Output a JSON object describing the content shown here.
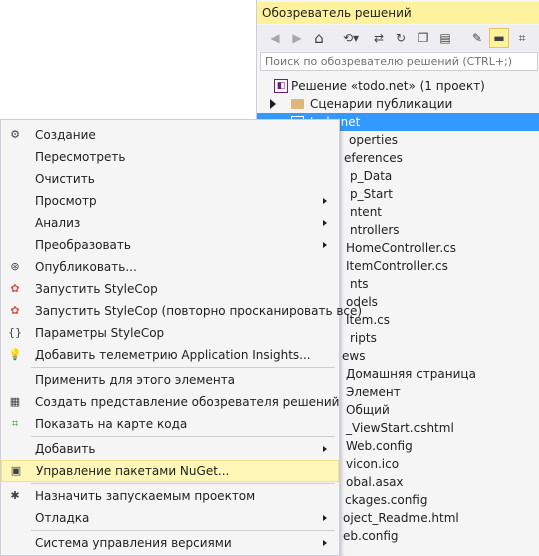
{
  "solution_explorer": {
    "title": "Обозреватель решений",
    "toolbar": [
      {
        "icon": "back-icon",
        "glyph": "◀"
      },
      {
        "icon": "forward-icon",
        "glyph": "▶"
      },
      {
        "icon": "home-icon",
        "glyph": "⌂"
      },
      {
        "icon": "history-icon",
        "glyph": "⟲▾"
      },
      {
        "icon": "sync-icon",
        "glyph": "⇄"
      },
      {
        "icon": "refresh-icon",
        "glyph": "↻"
      },
      {
        "icon": "collapse-all-icon",
        "glyph": "❐"
      },
      {
        "icon": "show-all-files-icon",
        "glyph": "▤"
      },
      {
        "icon": "properties-wrench-icon",
        "glyph": "✎"
      },
      {
        "icon": "preview-pin-icon",
        "glyph": "▬"
      },
      {
        "icon": "view-class-diagram-icon",
        "glyph": "⌗"
      }
    ],
    "search_placeholder": "Поиск по обозревателю решений (CTRL+;)",
    "tree": [
      {
        "text": "Решение «todo.net» (1 проект)"
      },
      {
        "text": "Сценарии публикации"
      },
      {
        "text": "todo.net"
      },
      {
        "text": "operties"
      },
      {
        "text": "eferences"
      },
      {
        "text": "p_Data"
      },
      {
        "text": "p_Start"
      },
      {
        "text": "ntent"
      },
      {
        "text": "ntrollers"
      },
      {
        "text": "HomeController.cs"
      },
      {
        "text": "ItemController.cs"
      },
      {
        "text": "nts"
      },
      {
        "text": "odels"
      },
      {
        "text": "Item.cs"
      },
      {
        "text": "ripts"
      },
      {
        "text": "ews"
      },
      {
        "text": "Домашняя страница"
      },
      {
        "text": "Элемент"
      },
      {
        "text": "Общий"
      },
      {
        "text": "_ViewStart.cshtml"
      },
      {
        "text": "Web.config"
      },
      {
        "text": "vicon.ico"
      },
      {
        "text": "obal.asax"
      },
      {
        "text": "ckages.config"
      },
      {
        "text": "oject_Readme.html"
      },
      {
        "text": "eb.config"
      }
    ]
  },
  "context_menu": {
    "items": [
      {
        "label": "Создание",
        "icon": "build-icon",
        "glyph": "⚙"
      },
      {
        "label": "Пересмотреть",
        "icon": "",
        "glyph": ""
      },
      {
        "label": "Очистить",
        "icon": "",
        "glyph": ""
      },
      {
        "label": "Просмотр",
        "icon": "",
        "glyph": "",
        "submenu": true
      },
      {
        "label": "Анализ",
        "icon": "",
        "glyph": "",
        "submenu": true
      },
      {
        "label": "Преобразовать",
        "icon": "",
        "glyph": "",
        "submenu": true
      },
      {
        "label": "Опубликовать...",
        "icon": "publish-icon",
        "glyph": "⊛"
      },
      {
        "label": "Запустить StyleCop",
        "icon": "stylecop-icon",
        "glyph": "✿"
      },
      {
        "label": "Запустить StyleCop (повторно просканировать все)",
        "icon": "stylecop-rescan-icon",
        "glyph": "✿"
      },
      {
        "label": "Параметры StyleCop",
        "icon": "settings-braces-icon",
        "glyph": "{}"
      },
      {
        "label": "Добавить телеметрию Application Insights...",
        "icon": "lightbulb-add-icon",
        "glyph": "💡"
      },
      {
        "label": "Применить для этого элемента",
        "icon": "",
        "glyph": ""
      },
      {
        "label": "Создать представление обозревателя решений",
        "icon": "new-view-icon",
        "glyph": "▦"
      },
      {
        "label": "Показать на карте кода",
        "icon": "code-map-icon",
        "glyph": "⌗"
      },
      {
        "label": "Добавить",
        "icon": "",
        "glyph": "",
        "submenu": true
      },
      {
        "label": "Управление пакетами NuGet...",
        "icon": "nuget-icon",
        "glyph": "▣",
        "highlighted": true
      },
      {
        "label": "Назначить запускаемым проектом",
        "icon": "gear-icon",
        "glyph": "✱"
      },
      {
        "label": "Отладка",
        "icon": "",
        "glyph": "",
        "submenu": true
      },
      {
        "label": "Система управления версиями",
        "icon": "",
        "glyph": "",
        "submenu": true
      }
    ]
  }
}
